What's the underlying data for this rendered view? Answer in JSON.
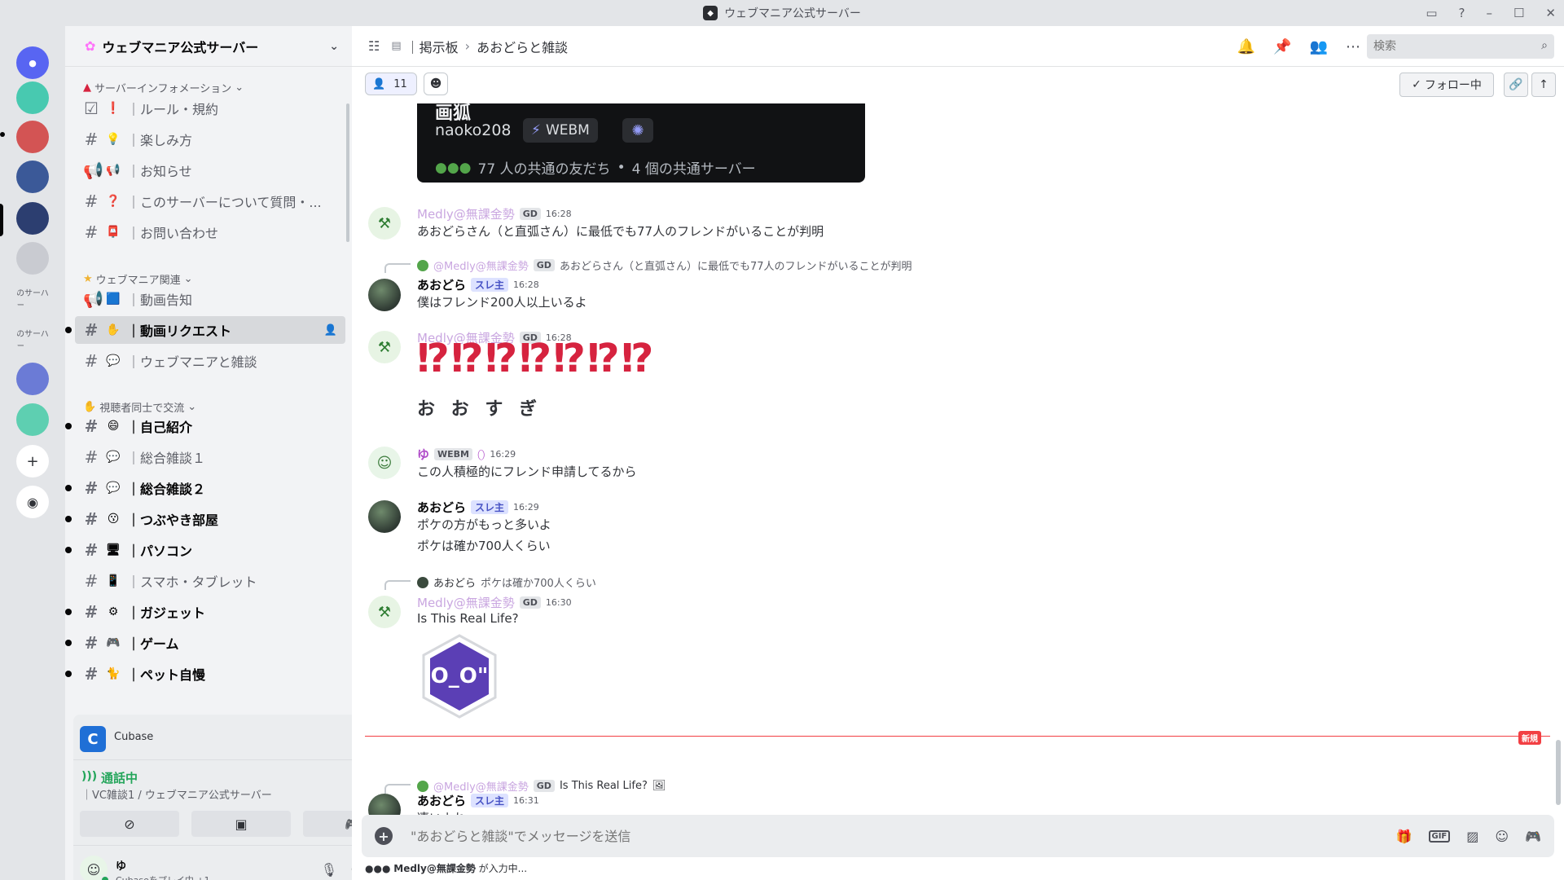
{
  "titlebar": {
    "title": "ウェブマニア公式サーバー"
  },
  "rail": {
    "servers": [
      {
        "label": "",
        "color": "#5865f2",
        "top": 0
      },
      {
        "label": "",
        "color": "#48c9b0"
      },
      {
        "label": "",
        "color": "#d35454"
      },
      {
        "label": "",
        "color": "#3b5998"
      },
      {
        "label": "",
        "color": "#2c3e70"
      },
      {
        "label": "",
        "color": "#c9cbd1"
      },
      {
        "label": "のサーバー",
        "color": "#e3e5e8"
      },
      {
        "label": "のサーバー",
        "color": "#e3e5e8"
      },
      {
        "label": "",
        "color": "#6b7bd6"
      },
      {
        "label": "",
        "color": "#5ecfb1"
      }
    ]
  },
  "sidebar": {
    "server_name": "ウェブマニア公式サーバー",
    "categories": [
      {
        "name": "サーバーインフォメーション"
      },
      {
        "name": "ウェブマニア関連"
      },
      {
        "name": "視聴者同士で交流"
      }
    ],
    "channels": [
      {
        "emoji": "❗",
        "name": "｜ルール・規約"
      },
      {
        "emoji": "💡",
        "name": "｜楽しみ方"
      },
      {
        "emoji": "📢",
        "name": "｜お知らせ"
      },
      {
        "emoji": "❓",
        "name": "｜このサーバーについて質問・..."
      },
      {
        "emoji": "📮",
        "name": "｜お問い合わせ"
      },
      {
        "emoji": "🟦",
        "name": "｜動画告知"
      },
      {
        "emoji": "✋",
        "name": "｜動画リクエスト"
      },
      {
        "emoji": "💬",
        "name": "｜ウェブマニアと雑談"
      },
      {
        "emoji": "😄",
        "name": "｜自己紹介"
      },
      {
        "emoji": "💬",
        "name": "｜総合雑談１"
      },
      {
        "emoji": "💬",
        "name": "｜総合雑談２"
      },
      {
        "emoji": "😗",
        "name": "｜つぶやき部屋"
      },
      {
        "emoji": "🖥",
        "name": "｜パソコン"
      },
      {
        "emoji": "📱",
        "name": "｜スマホ・タブレット"
      },
      {
        "emoji": "⚙",
        "name": "｜ガジェット"
      },
      {
        "emoji": "🎮",
        "name": "｜ゲーム"
      },
      {
        "emoji": "🐈",
        "name": "｜ペット自慢"
      }
    ]
  },
  "activity": {
    "app_name": "Cubase",
    "voice_status": "通話中",
    "voice_channel": "｜VC雑談1 / ウェブマニア公式サーバー",
    "user_name": "ゆ",
    "user_status": "Cubaseをプレイ中 +1"
  },
  "topbar": {
    "crumb_forum": "｜掲示板",
    "crumb_thread": "あおどらと雑談",
    "search_placeholder": "検索",
    "members_count": "11",
    "follow_label": "フォロー中"
  },
  "profile_card": {
    "title": "画狐",
    "username": "naoko208",
    "badge": "WEBM",
    "mutuals": "77 人の共通の友だち",
    "mutual_servers": "4 個の共通サーバー"
  },
  "messages": [
    {
      "author": "Medly@無課金勢",
      "tag": "GD",
      "time": "16:28",
      "text": "あおどらさん（と直弧さん）に最低でも77人のフレンドがいることが判明"
    },
    {
      "reply_author": "@Medly@無課金勢",
      "reply_tag": "GD",
      "reply_text": "あおどらさん（と直弧さん）に最低でも77人のフレンドがいることが判明",
      "author": "あおどら",
      "tag": "スレ主",
      "time": "16:28",
      "text": "僕はフレンド200人以上いるよ"
    },
    {
      "author": "Medly@無課金勢",
      "tag": "GD",
      "time": "16:28",
      "big": "⁉⁉⁉⁉⁉⁉⁉",
      "text": "お お す ぎ"
    },
    {
      "author": "ゆ",
      "tag": "WEBM",
      "time": "16:29",
      "text": "この人積極的にフレンド申請してるから"
    },
    {
      "author": "あおどら",
      "tag": "スレ主",
      "time": "16:29",
      "text": "ポケの方がもっと多いよ",
      "text2": "ポケは確か700人くらい"
    },
    {
      "reply_author": "あおどら",
      "reply_text": "ポケは確か700人くらい",
      "author": "Medly@無課金勢",
      "tag": "GD",
      "time": "16:30",
      "text": "Is This Real Life?",
      "sticker": "O_O\""
    },
    {
      "reply_author": "@Medly@無課金勢",
      "reply_tag": "GD",
      "reply_text": "Is This Real Life?",
      "author": "あおどら",
      "tag": "スレ主",
      "time": "16:31",
      "text": "凄いよね"
    }
  ],
  "new_badge": "新規",
  "composer": {
    "placeholder": "\"あおどらと雑談\"でメッセージを送信",
    "gif_label": "GIF"
  },
  "typing": {
    "user": "Medly@無課金勢",
    "suffix": " が入力中..."
  }
}
